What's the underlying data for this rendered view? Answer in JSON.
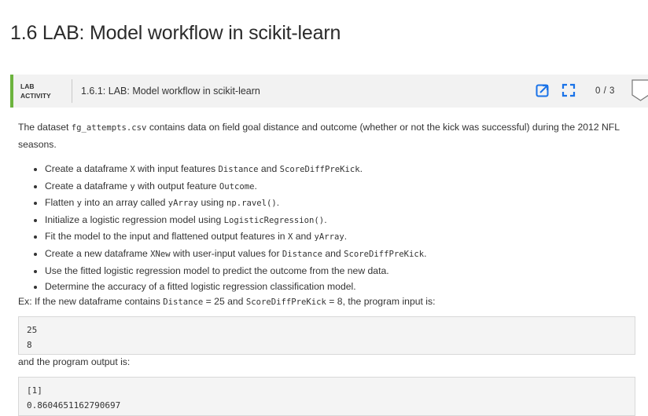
{
  "page": {
    "title": "1.6 LAB: Model workflow in scikit-learn"
  },
  "lab": {
    "tag_line1": "LAB",
    "tag_line2": "ACTIVITY",
    "title": "1.6.1: LAB: Model workflow in scikit-learn",
    "score": "0 / 3",
    "accent_color": "#6cb33e",
    "icon_color": "#1a73e8",
    "icons": [
      "open-in-new-icon",
      "fullscreen-icon"
    ]
  },
  "intro": {
    "p1": "The dataset ",
    "file": "fg_attempts.csv",
    "p2": " contains data on field goal distance and outcome (whether or not the kick was successful) during the 2012 NFL seasons."
  },
  "tasks": [
    {
      "parts": [
        {
          "t": "Create a dataframe "
        },
        {
          "c": "X"
        },
        {
          "t": " with input features "
        },
        {
          "c": "Distance"
        },
        {
          "t": " and "
        },
        {
          "c": "ScoreDiffPreKick"
        },
        {
          "t": "."
        }
      ]
    },
    {
      "parts": [
        {
          "t": "Create a dataframe "
        },
        {
          "c": "y"
        },
        {
          "t": " with output feature "
        },
        {
          "c": "Outcome"
        },
        {
          "t": "."
        }
      ]
    },
    {
      "parts": [
        {
          "t": "Flatten "
        },
        {
          "c": "y"
        },
        {
          "t": " into an array called "
        },
        {
          "c": "yArray"
        },
        {
          "t": " using "
        },
        {
          "c": "np.ravel()"
        },
        {
          "t": "."
        }
      ]
    },
    {
      "parts": [
        {
          "t": "Initialize a logistic regression model using "
        },
        {
          "c": "LogisticRegression()"
        },
        {
          "t": "."
        }
      ]
    },
    {
      "parts": [
        {
          "t": "Fit the model to the input and flattened output features in "
        },
        {
          "c": "X"
        },
        {
          "t": " and "
        },
        {
          "c": "yArray"
        },
        {
          "t": "."
        }
      ]
    },
    {
      "parts": [
        {
          "t": "Create a new dataframe "
        },
        {
          "c": "XNew"
        },
        {
          "t": " with user-input values for "
        },
        {
          "c": "Distance"
        },
        {
          "t": " and "
        },
        {
          "c": "ScoreDiffPreKick"
        },
        {
          "t": "."
        }
      ]
    },
    {
      "parts": [
        {
          "t": "Use the fitted logistic regression model to predict the outcome from the new data."
        }
      ]
    },
    {
      "parts": [
        {
          "t": "Determine the accuracy of a fitted logistic regression classification model."
        }
      ]
    }
  ],
  "example": {
    "parts": [
      {
        "t": "Ex: If the new dataframe contains "
      },
      {
        "c": "Distance"
      },
      {
        "t": " = 25 and "
      },
      {
        "c": "ScoreDiffPreKick"
      },
      {
        "t": " = 8, the program input is:"
      }
    ],
    "input": "25\n8",
    "output_label": "and the program output is:",
    "output": "[1]\n0.8604651162790697"
  }
}
